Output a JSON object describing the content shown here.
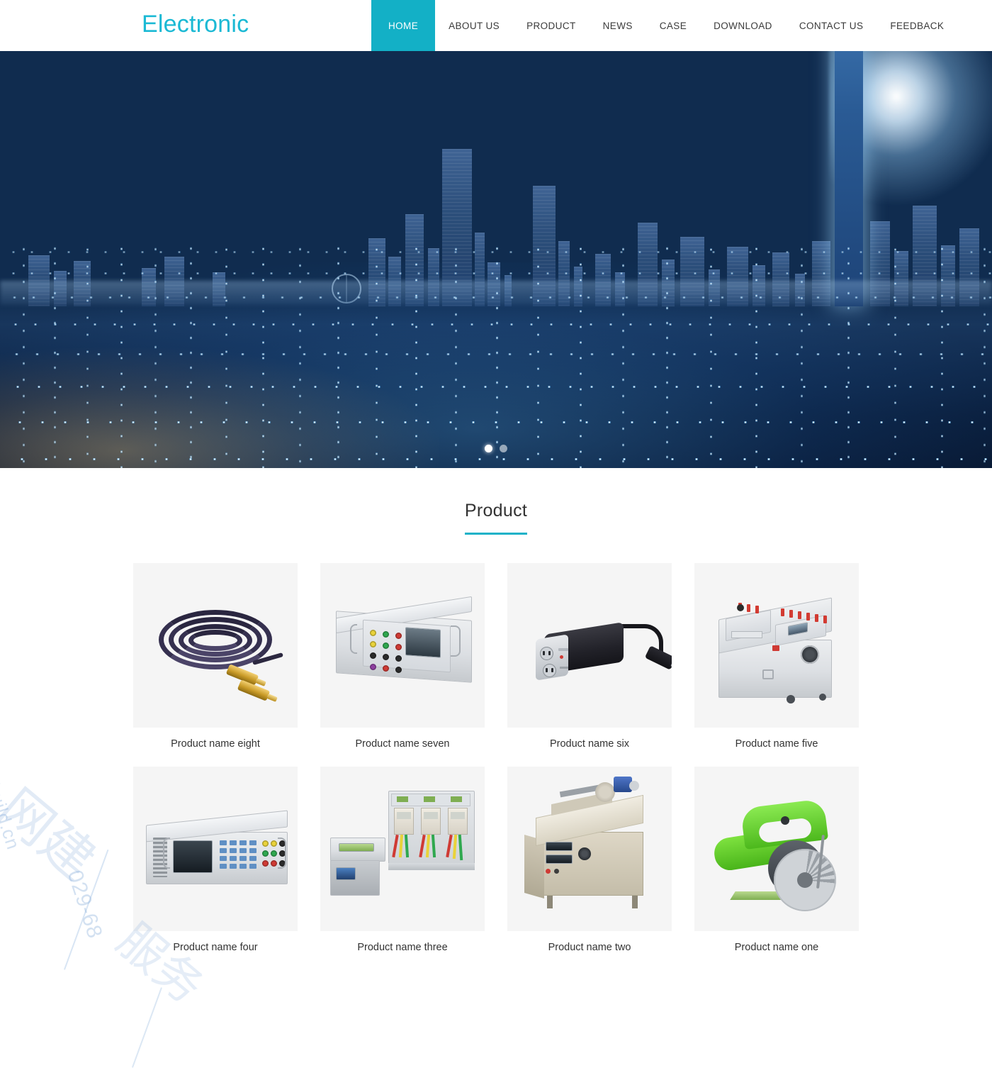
{
  "header": {
    "logo": "Electronic",
    "nav": [
      {
        "label": "HOME",
        "active": true
      },
      {
        "label": "ABOUT US",
        "active": false
      },
      {
        "label": "PRODUCT",
        "active": false
      },
      {
        "label": "NEWS",
        "active": false
      },
      {
        "label": "CASE",
        "active": false
      },
      {
        "label": "DOWNLOAD",
        "active": false
      },
      {
        "label": "CONTACT US",
        "active": false
      },
      {
        "label": "FEEDBACK",
        "active": false
      }
    ],
    "accent_color": "#13b0c6",
    "logo_color": "#1bb9d4"
  },
  "hero": {
    "alt": "city skyline at dusk with glowing blue data mesh",
    "slides": 2,
    "active_slide": 1,
    "dots": [
      {
        "name": "slide-1",
        "active": true
      },
      {
        "name": "slide-2",
        "active": false
      }
    ]
  },
  "product_section": {
    "title": "Product",
    "rule_color": "#19b2c8",
    "items": [
      {
        "name": "Product name eight",
        "art": "cable",
        "icon": "coiled-audio-cable"
      },
      {
        "name": "Product name seven",
        "art": "instrument1",
        "icon": "bench-test-instrument"
      },
      {
        "name": "Product name six",
        "art": "inverter",
        "icon": "car-power-inverter"
      },
      {
        "name": "Product name five",
        "art": "cabinet",
        "icon": "mobile-test-cabinet"
      },
      {
        "name": "Product name four",
        "art": "rack",
        "icon": "rack-mount-calibrator"
      },
      {
        "name": "Product name three",
        "art": "meterbench",
        "icon": "energy-meter-test-bench"
      },
      {
        "name": "Product name two",
        "art": "winder",
        "icon": "coil-winding-machine"
      },
      {
        "name": "Product name one",
        "art": "saw",
        "icon": "circular-marble-saw"
      }
    ]
  },
  "watermark": {
    "latin": "wbuild.cn",
    "phone": "029-68",
    "cjk_1": "网建",
    "cjk_2": "服务"
  }
}
